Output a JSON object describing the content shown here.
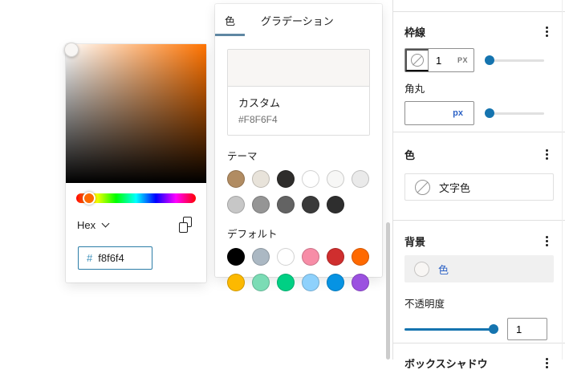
{
  "picker": {
    "format_label": "Hex",
    "hex_prefix": "#",
    "hex_value": "f8f6f4",
    "hue_base_color": "#ff7300",
    "hue_handle_color": "#ff6a00",
    "picked_color": "#f8f6f4"
  },
  "panel": {
    "tab_color": "色",
    "tab_gradient": "グラデーション",
    "custom_label": "カスタム",
    "custom_value": "#F8F6F4",
    "custom_swatch": "#f8f6f4",
    "theme_label": "テーマ",
    "theme_rows": [
      [
        "#b18c62",
        "#e8e3da",
        "#2e2d2b",
        "#ffffff",
        "#f7f7f6",
        "#eaeaea"
      ],
      [
        "#c7c7c7",
        "#959595",
        "#636363",
        "#3a3a3a",
        "#2e2e2e"
      ]
    ],
    "default_label": "デフォルト",
    "default_rows": [
      [
        "#000000",
        "#abb8c3",
        "#ffffff",
        "#f78da7",
        "#cf2e2e",
        "#ff6900"
      ],
      [
        "#fcb900",
        "#7bdcb5",
        "#00d084",
        "#8ed1fc",
        "#0693e3",
        "#9b51e0"
      ]
    ]
  },
  "sidebar": {
    "border_title": "枠線",
    "border_width_value": "1",
    "border_width_unit": "PX",
    "radius_label": "角丸",
    "radius_unit": "px",
    "color_title": "色",
    "text_color_label": "文字色",
    "background_title": "背景",
    "background_color_label": "色",
    "background_swatch": "#f8f6f4",
    "opacity_label": "不透明度",
    "opacity_value": "1",
    "box_shadow_title": "ボックスシャドウ"
  },
  "colors": {
    "accent_blue": "#1574af",
    "link_blue": "#2e63c6",
    "tab_underline": "#5f87a3",
    "hex_prefix_blue": "#3a8fba"
  }
}
